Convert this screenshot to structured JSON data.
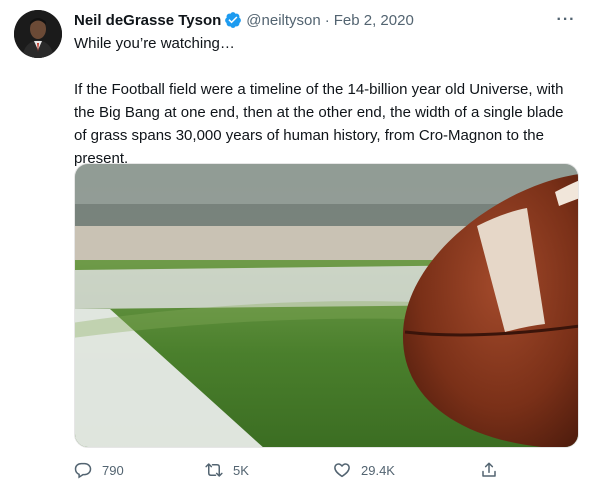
{
  "tweet": {
    "author_name": "Neil deGrasse Tyson",
    "handle": "@neiltyson",
    "separator": "·",
    "date": "Feb 2, 2020",
    "more_label": "···",
    "paragraph_1": "While you’re watching…",
    "paragraph_2": "If the Football field were a timeline of the 14-billion year old Universe, with the Big Bang at one end, then at the other end, the width of a single blade of grass spans 30,000 years of human history, from Cro-Magnon to the present."
  },
  "actions": {
    "reply_count": "790",
    "retweet_count": "5K",
    "like_count": "29.4K"
  },
  "icons": {
    "verified": "verified-badge-icon",
    "more": "more-options-icon",
    "reply": "reply-icon",
    "retweet": "retweet-icon",
    "like": "heart-icon",
    "share": "share-icon"
  },
  "colors": {
    "verified_blue": "#1d9bf0",
    "secondary_text": "#536471",
    "primary_text": "#0f1419"
  }
}
